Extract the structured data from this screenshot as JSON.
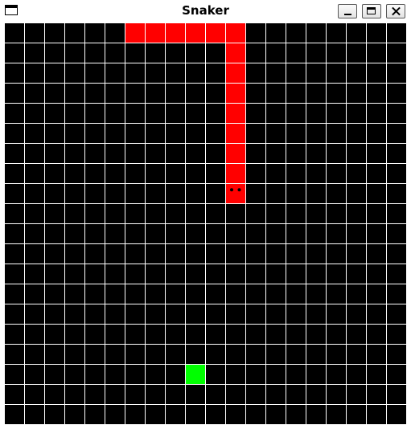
{
  "window": {
    "title": "Snaker"
  },
  "game": {
    "grid_columns": 20,
    "grid_rows": 20,
    "colors": {
      "background": "#000000",
      "grid_lines": "#ffffff",
      "snake": "#ff0000",
      "food": "#00ff00",
      "snake_eyes": "#000000"
    },
    "snake": {
      "direction": "down",
      "segments": [
        {
          "col": 6,
          "row": 0
        },
        {
          "col": 7,
          "row": 0
        },
        {
          "col": 8,
          "row": 0
        },
        {
          "col": 9,
          "row": 0
        },
        {
          "col": 10,
          "row": 0
        },
        {
          "col": 11,
          "row": 0
        },
        {
          "col": 11,
          "row": 1
        },
        {
          "col": 11,
          "row": 2
        },
        {
          "col": 11,
          "row": 3
        },
        {
          "col": 11,
          "row": 4
        },
        {
          "col": 11,
          "row": 5
        },
        {
          "col": 11,
          "row": 6
        },
        {
          "col": 11,
          "row": 7
        },
        {
          "col": 11,
          "row": 8
        }
      ]
    },
    "food": {
      "col": 9,
      "row": 17
    }
  }
}
